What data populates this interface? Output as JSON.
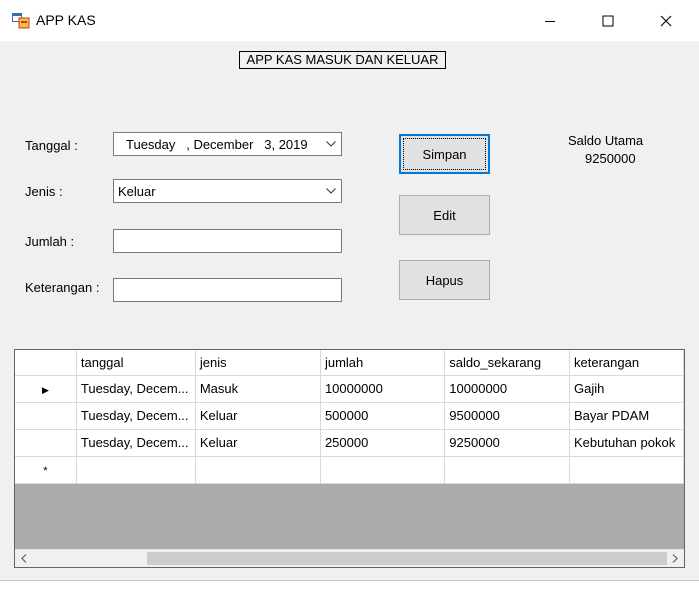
{
  "window": {
    "title": "APP KAS",
    "icon": "app-form-icon",
    "controls": [
      "minimize-icon",
      "maximize-icon",
      "close-icon"
    ]
  },
  "header": {
    "label": "APP KAS MASUK DAN KELUAR"
  },
  "form": {
    "tanggal_label": "Tanggal :",
    "tanggal_value": "Tuesday   , December   3, 2019",
    "jenis_label": "Jenis :",
    "jenis_value": "Keluar",
    "jumlah_label": "Jumlah :",
    "jumlah_value": "",
    "keterangan_label": "Keterangan :",
    "keterangan_value": ""
  },
  "buttons": {
    "simpan": "Simpan",
    "edit": "Edit",
    "hapus": "Hapus"
  },
  "saldo": {
    "label": "Saldo Utama",
    "value": "9250000"
  },
  "grid": {
    "columns": [
      "tanggal",
      "jenis",
      "jumlah",
      "saldo_sekarang",
      "keterangan"
    ],
    "rows": [
      {
        "tanggal": "Tuesday, Decem...",
        "jenis": "Masuk",
        "jumlah": "10000000",
        "saldo_sekarang": "10000000",
        "keterangan": "Gajih"
      },
      {
        "tanggal": "Tuesday, Decem...",
        "jenis": "Keluar",
        "jumlah": "500000",
        "saldo_sekarang": "9500000",
        "keterangan": "Bayar PDAM"
      },
      {
        "tanggal": "Tuesday, Decem...",
        "jenis": "Keluar",
        "jumlah": "250000",
        "saldo_sekarang": "9250000",
        "keterangan": "Kebutuhan pokok"
      }
    ],
    "current_row_marker": "▶",
    "new_row_marker": "*"
  },
  "colors": {
    "accent": "#0078d7",
    "form_bg": "#f0f0f0",
    "grid_bg": "#ababab"
  }
}
